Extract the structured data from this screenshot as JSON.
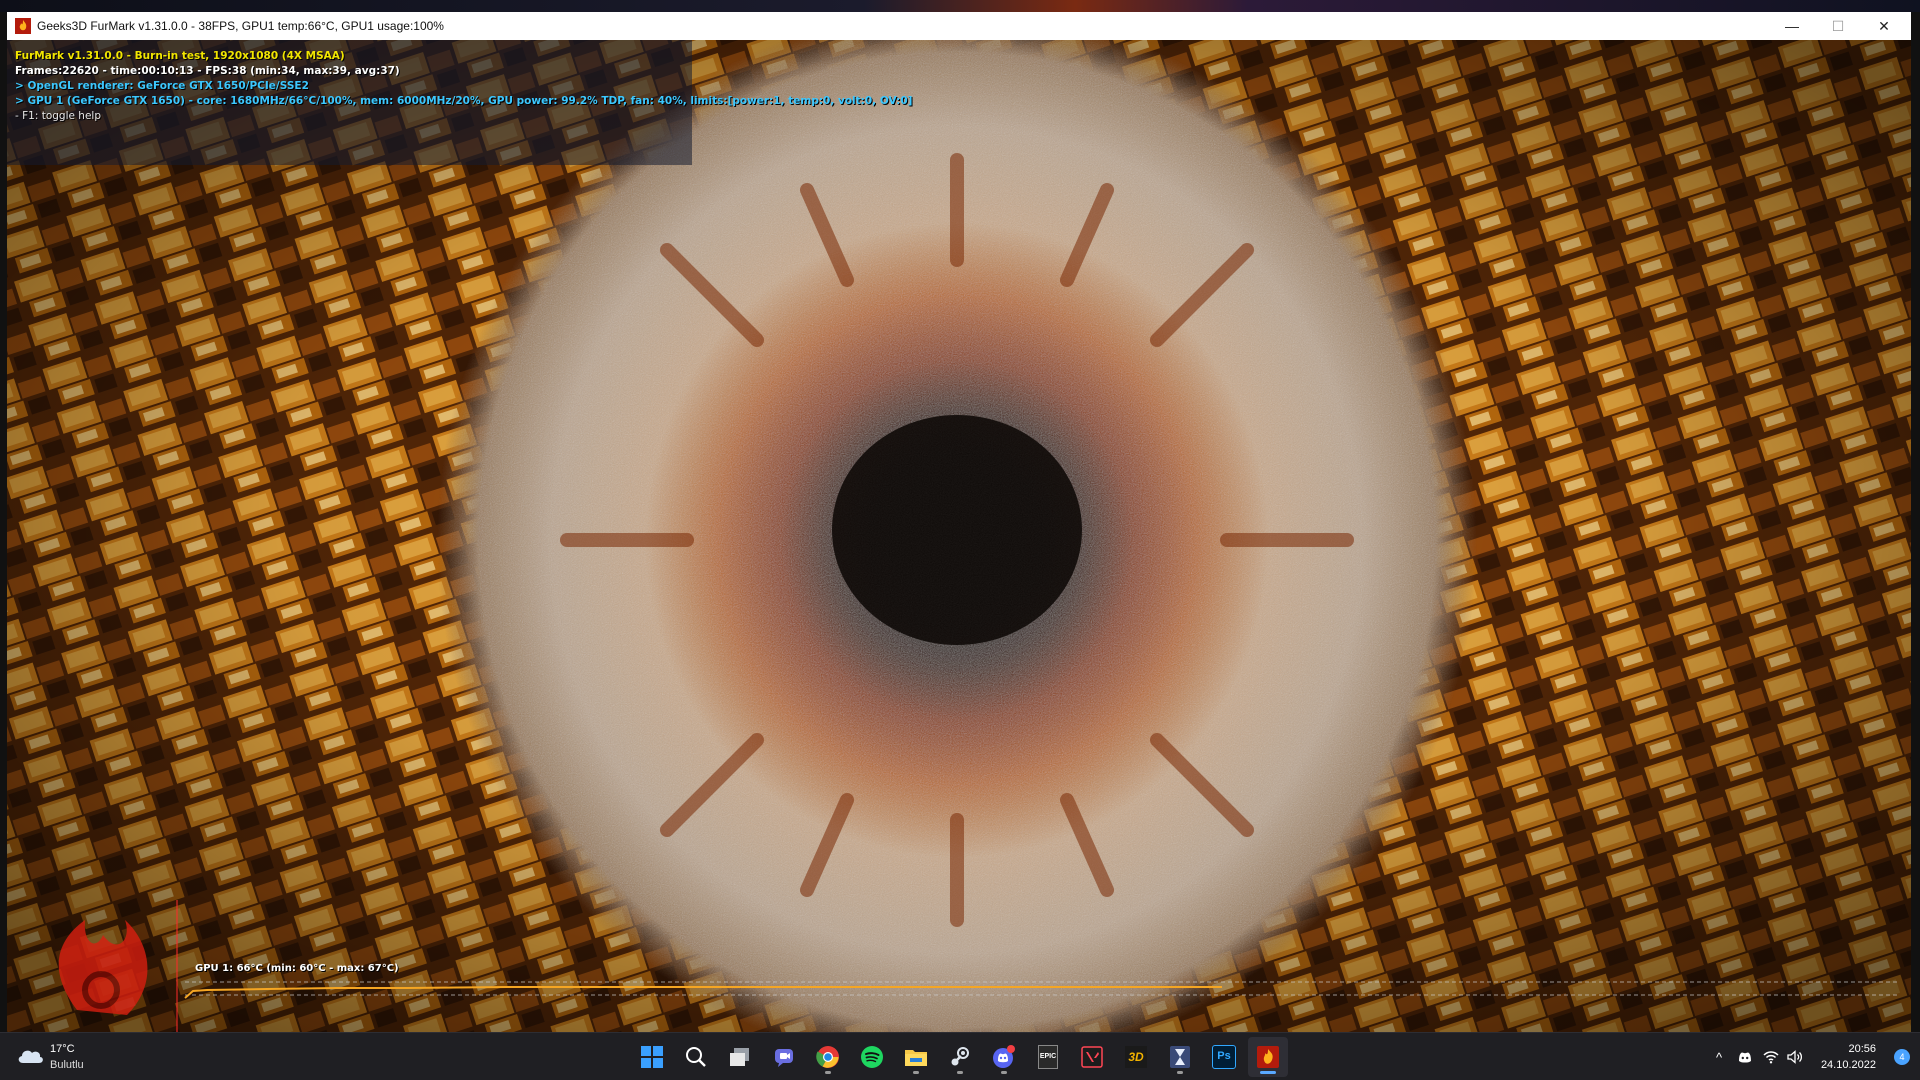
{
  "window": {
    "title": "Geeks3D FurMark v1.31.0.0 - 38FPS, GPU1 temp:66°C, GPU1 usage:100%",
    "minimize_glyph": "—",
    "maximize_glyph": "☐",
    "close_glyph": "✕",
    "app_icon": "furmark-flame-icon"
  },
  "hud": {
    "line1": "FurMark v1.31.0.0 - Burn-in test, 1920x1080 (4X MSAA)",
    "line2": "Frames:22620 - time:00:10:13 - FPS:38 (min:34, max:39, avg:37)",
    "line3": "> OpenGL renderer: GeForce GTX 1650/PCIe/SSE2",
    "line4": "> GPU 1 (GeForce GTX 1650) - core: 1680MHz/66°C/100%, mem: 6000MHz/20%, GPU power: 99.2% TDP, fan: 40%, limits:[power:1, temp:0, volt:0, OV:0]",
    "line5": "- F1: toggle help",
    "colors": {
      "title": "#f2e600",
      "stats": "#ffffff",
      "renderer": "#3cc8ff",
      "gpu": "#3cc8ff",
      "help": "#e8e8e8"
    }
  },
  "temp_graph": {
    "label": "GPU 1: 66°C (min: 60°C - max: 67°C)",
    "current_c": 66,
    "min_c": 60,
    "max_c": 67,
    "line_color": "#f5a623"
  },
  "taskbar": {
    "weather": {
      "temp": "17°C",
      "condition": "Bulutlu",
      "icon": "cloud-icon"
    },
    "apps": [
      {
        "name": "start-button",
        "icon": "windows-icon"
      },
      {
        "name": "search-button",
        "icon": "search-icon"
      },
      {
        "name": "task-view-button",
        "icon": "task-view-icon"
      },
      {
        "name": "teams-chat-button",
        "icon": "chat-icon"
      },
      {
        "name": "chrome-button",
        "icon": "chrome-icon"
      },
      {
        "name": "spotify-button",
        "icon": "spotify-icon"
      },
      {
        "name": "file-explorer-button",
        "icon": "folder-icon"
      },
      {
        "name": "steam-button",
        "icon": "steam-icon"
      },
      {
        "name": "discord-button",
        "icon": "discord-icon"
      },
      {
        "name": "epic-games-button",
        "icon": "epic-games-icon"
      },
      {
        "name": "valorant-button",
        "icon": "valorant-icon"
      },
      {
        "name": "3dmark-button",
        "icon": "3dmark-icon"
      },
      {
        "name": "hourglass-app-button",
        "icon": "hourglass-icon"
      },
      {
        "name": "photoshop-button",
        "icon": "photoshop-icon"
      },
      {
        "name": "furmark-button",
        "icon": "furmark-flame-icon"
      }
    ],
    "epic_label": "EPIC",
    "threedmark_label": "3D",
    "photoshop_label": "Ps",
    "tray": {
      "chevron": "^",
      "wifi": "wifi-icon",
      "volume": "volume-icon",
      "discord": "discord-tray-icon"
    },
    "time": "20:56",
    "date": "24.10.2022",
    "notification_count": "4"
  }
}
